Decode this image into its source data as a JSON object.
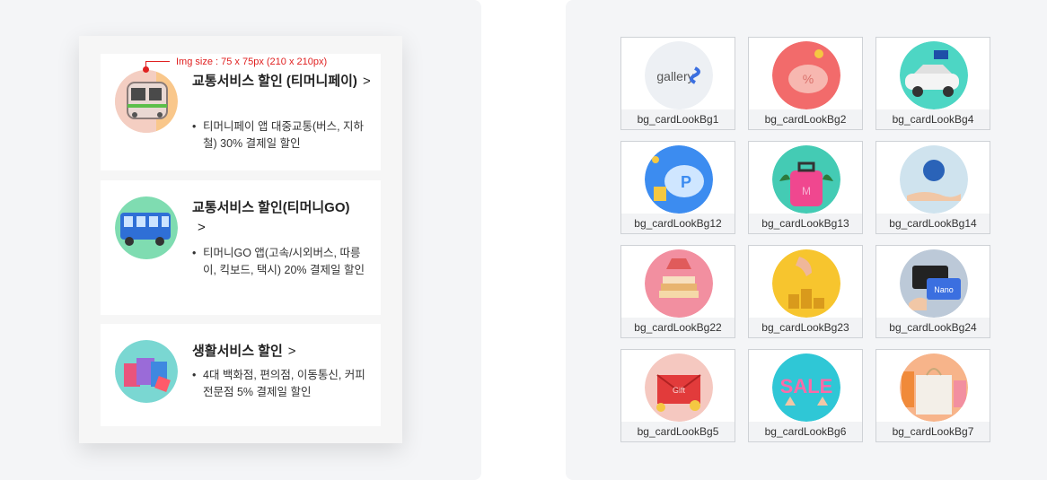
{
  "annotation": {
    "text": "Img size : 75 x 75px (210 x 210px)"
  },
  "cards": [
    {
      "title": "교통서비스 할인 (티머니페이)",
      "chevron": ">",
      "desc": "티머니페이 앱 대중교통(버스, 지하철) 30% 결제일 할인",
      "icon": "subway-train-icon"
    },
    {
      "title": "교통서비스 할인(티머니GO)",
      "chevron": ">",
      "desc": "티머니GO 앱(고속/시외버스, 따릉이, 킥보드, 택시) 20% 결제일 할인",
      "icon": "bus-icon"
    },
    {
      "title": "생활서비스 할인",
      "chevron": ">",
      "desc": "4대 백화점, 편의점, 이동통신, 커피전문점 5% 결제일 할인",
      "icon": "shopping-bags-icon"
    }
  ],
  "gallery": [
    {
      "label": "bg_cardLookBg1",
      "icon": "gallery-logo-icon",
      "logo_text": "gallery"
    },
    {
      "label": "bg_cardLookBg2",
      "icon": "piggy-bank-percent-icon"
    },
    {
      "label": "bg_cardLookBg4",
      "icon": "car-icon"
    },
    {
      "label": "bg_cardLookBg12",
      "icon": "piggy-bank-coins-icon"
    },
    {
      "label": "bg_cardLookBg13",
      "icon": "suitcase-icon"
    },
    {
      "label": "bg_cardLookBg14",
      "icon": "hand-logo-icon"
    },
    {
      "label": "bg_cardLookBg22",
      "icon": "books-icon"
    },
    {
      "label": "bg_cardLookBg23",
      "icon": "coins-hand-icon"
    },
    {
      "label": "bg_cardLookBg24",
      "icon": "cards-hand-icon",
      "card_text": "Nano"
    },
    {
      "label": "bg_cardLookBg5",
      "icon": "gift-envelope-icon",
      "card_text": "Gift"
    },
    {
      "label": "bg_cardLookBg6",
      "icon": "sale-letters-icon",
      "card_text": "SALE"
    },
    {
      "label": "bg_cardLookBg7",
      "icon": "shopping-bag-icon"
    }
  ]
}
